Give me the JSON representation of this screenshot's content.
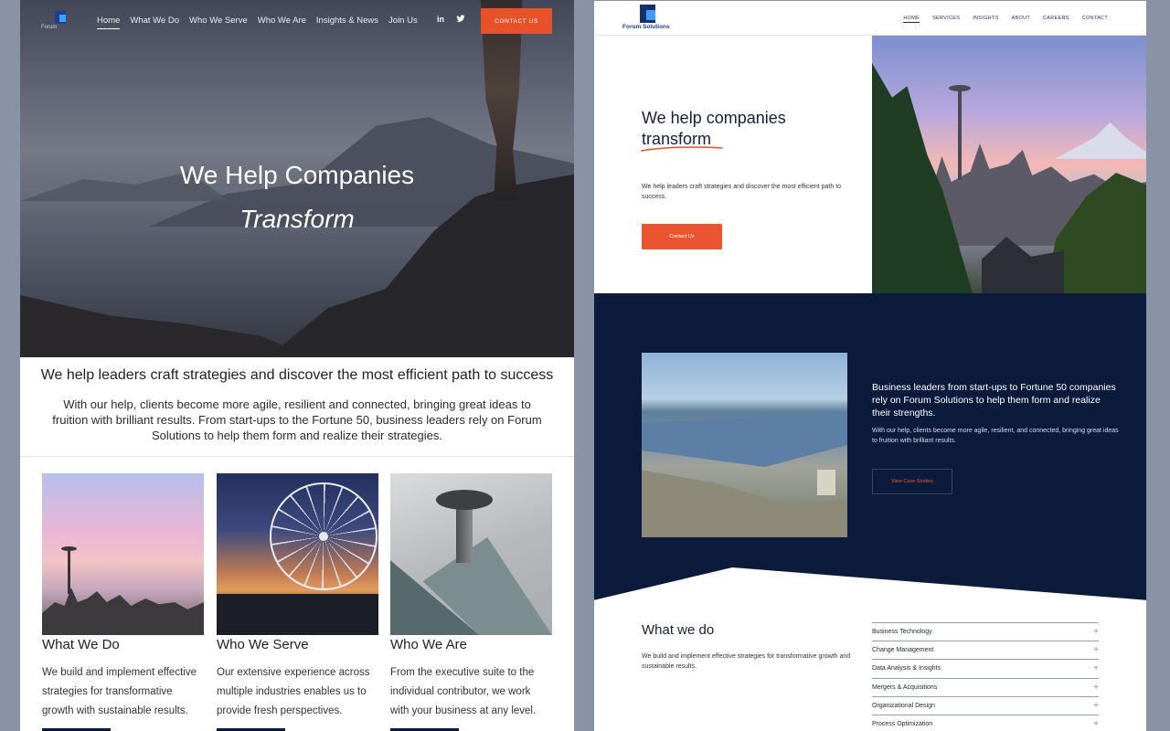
{
  "left": {
    "logo_text": "Forum",
    "nav": [
      "Home",
      "What We Do",
      "Who We Serve",
      "Who We Are",
      "Insights & News",
      "Join Us"
    ],
    "social": {
      "linkedin": "in",
      "twitter": "t"
    },
    "cta": "CONTACT US",
    "hero_line1": "We Help Companies",
    "hero_line2": "Transform",
    "intro_heading": "We help leaders craft strategies and discover the most efficient path to success",
    "intro_body": "With our help, clients become more agile, resilient and connected, bringing great ideas to fruition with brilliant results. From start-ups to the Fortune 50, business leaders rely on Forum Solutions to help them form and realize their strategies.",
    "cards": [
      {
        "title": "What We Do",
        "body": "We build and implement effective strategies for transformative growth with sustainable results."
      },
      {
        "title": "Who We Serve",
        "body": "Our extensive experience across multiple industries enables us to provide fresh perspectives."
      },
      {
        "title": "Who We Are",
        "body": "From the executive suite to the individual contributor, we work with your business at any level."
      }
    ]
  },
  "right": {
    "logo_text": "Forum Solutions",
    "nav": [
      "HOME",
      "SERVICES",
      "INSIGHTS",
      "ABOUT",
      "CAREERS",
      "CONTACT"
    ],
    "hero_line1": "We help companies",
    "hero_line2": "transform",
    "hero_body": "We help leaders craft strategies and discover the most efficient path to success.",
    "cta": "Contact Us",
    "dark_heading": "Business leaders from start-ups to Fortune 50 companies rely on Forum Solutions to help them form and realize their strengths.",
    "dark_body": "With our help, clients become more agile, resilient, and connected, bringing great ideas to fruition with brilliant results.",
    "dark_button": "View Case Studies",
    "what_heading": "What we do",
    "what_body": "We build and implement effective strategies for transformative growth and sustainable results.",
    "services": [
      "Business Technology",
      "Change Management",
      "Data Analysis & Insights",
      "Mergers & Acquisitions",
      "Organizational Design",
      "Process Optimization"
    ]
  },
  "colors": {
    "accent": "#e8522a",
    "navy": "#0c1a3c"
  }
}
